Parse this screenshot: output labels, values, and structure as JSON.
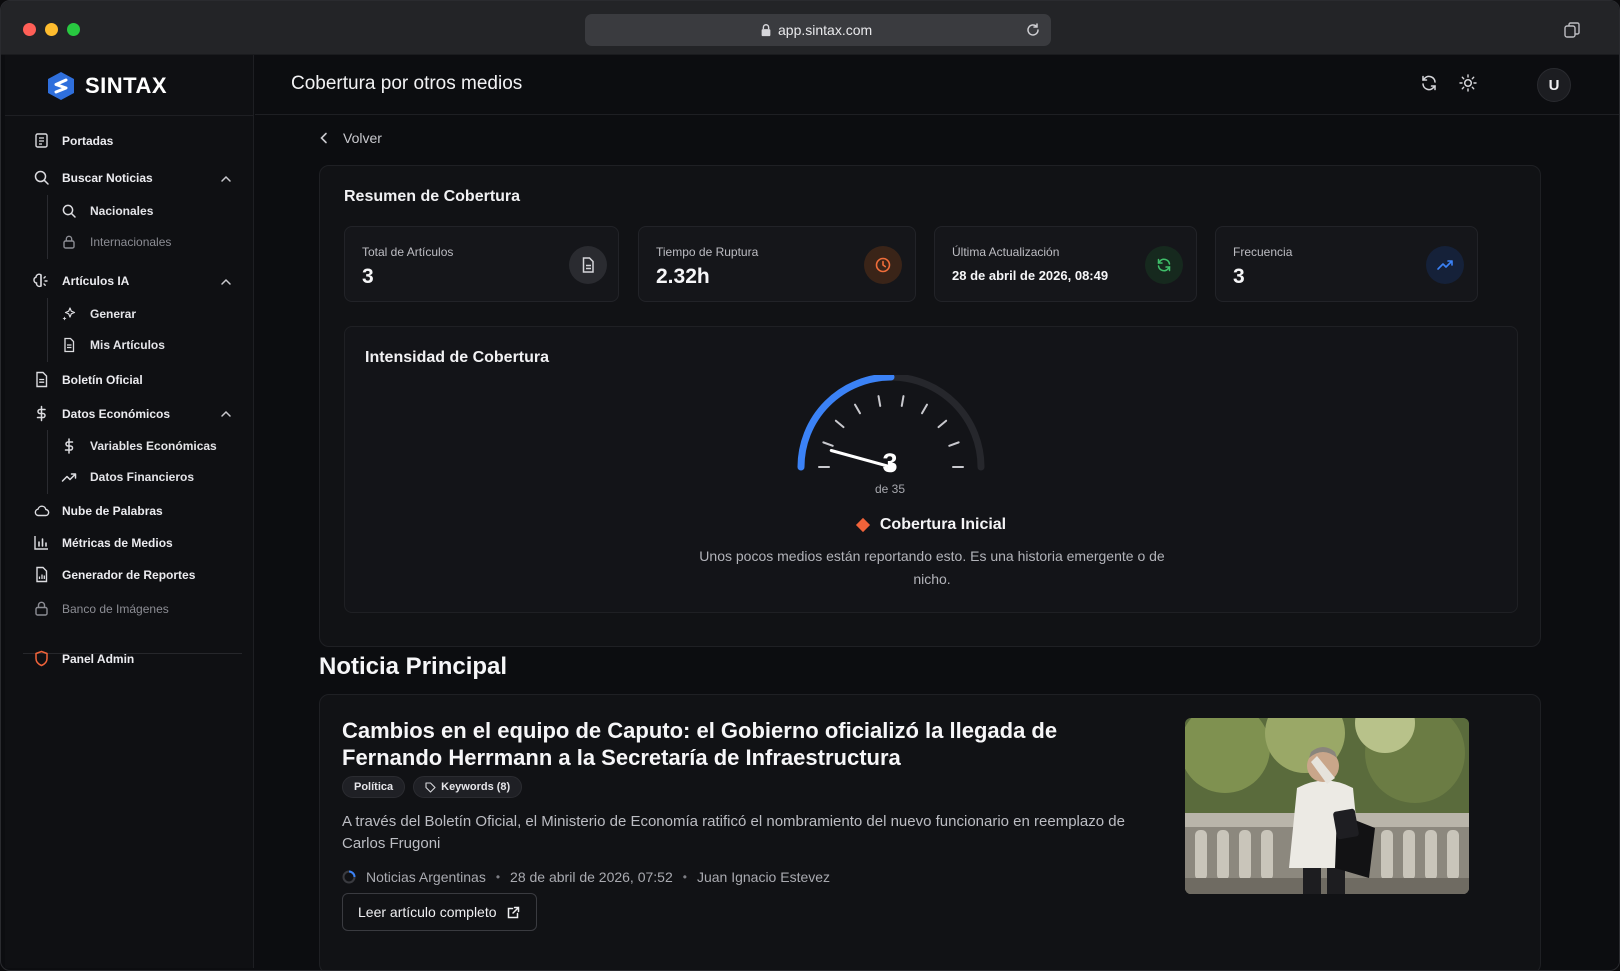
{
  "browser": {
    "url": "app.sintax.com"
  },
  "brand": {
    "name": "SINTAX"
  },
  "sidebar": {
    "items": [
      {
        "label": "Portadas"
      },
      {
        "label": "Buscar Noticias"
      },
      {
        "label": "Nacionales"
      },
      {
        "label": "Internacionales"
      },
      {
        "label": "Artículos IA"
      },
      {
        "label": "Generar"
      },
      {
        "label": "Mis Artículos"
      },
      {
        "label": "Boletín Oficial"
      },
      {
        "label": "Datos Económicos"
      },
      {
        "label": "Variables Económicas"
      },
      {
        "label": "Datos Financieros"
      },
      {
        "label": "Nube de Palabras"
      },
      {
        "label": "Métricas de Medios"
      },
      {
        "label": "Generador de Reportes"
      },
      {
        "label": "Banco de Imágenes"
      },
      {
        "label": "Panel Admin"
      }
    ]
  },
  "header": {
    "title": "Cobertura por otros medios",
    "avatar": "U"
  },
  "back": {
    "label": "Volver"
  },
  "summary": {
    "title": "Resumen de Cobertura",
    "stats": [
      {
        "label": "Total de Artículos",
        "value": "3",
        "icon": "document-icon",
        "color": "#c9c9ce"
      },
      {
        "label": "Tiempo de Ruptura",
        "value": "2.32h",
        "icon": "clock-icon",
        "color": "#f06d3a"
      },
      {
        "label": "Última Actualización",
        "value": "28 de abril de 2026, 08:49",
        "icon": "refresh-icon",
        "color": "#3fbf6a"
      },
      {
        "label": "Frecuencia",
        "value": "3",
        "icon": "trending-up-icon",
        "color": "#3b82f6"
      }
    ]
  },
  "intensity": {
    "title": "Intensidad de Cobertura",
    "value": 3,
    "max": 35,
    "value_text": "3",
    "of_text": "de 35",
    "level": "Cobertura Inicial",
    "level_color": "#f0633a",
    "description": "Unos pocos medios están reportando esto. Es una historia emergente o de nicho.",
    "accent": "#3b82f6"
  },
  "news": {
    "section_title": "Noticia Principal",
    "title": "Cambios en el equipo de Caputo: el Gobierno oficializó la llegada de Fernando Herrmann a la Secretaría de Infraestructura",
    "tags": [
      {
        "label": "Política"
      },
      {
        "label": "Keywords (8)"
      }
    ],
    "description": "A través del Boletín Oficial, el Ministerio de Economía ratificó el nombramiento del nuevo funcionario en reemplazo de Carlos Frugoni",
    "source": "Noticias Argentinas",
    "date": "28 de abril de 2026, 07:52",
    "author": "Juan Ignacio Estevez",
    "read_button": "Leer artículo completo"
  }
}
